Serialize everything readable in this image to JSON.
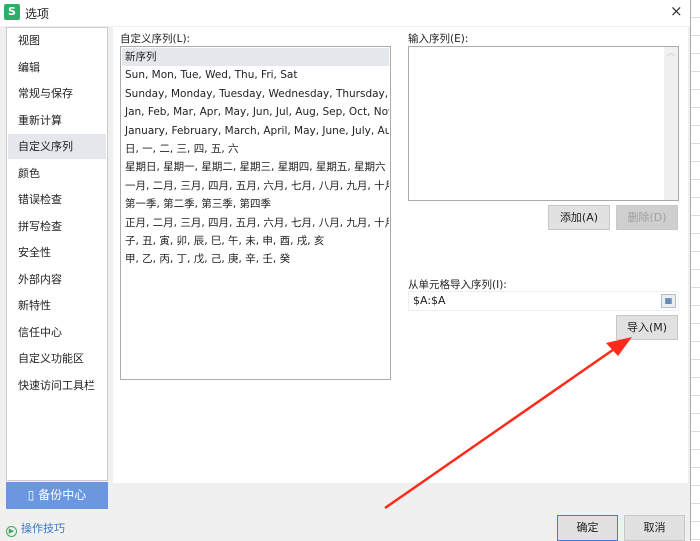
{
  "window": {
    "title": "选项",
    "app_icon": "S",
    "close_icon": "×"
  },
  "sidebar": {
    "items": [
      {
        "label": "视图"
      },
      {
        "label": "编辑"
      },
      {
        "label": "常规与保存"
      },
      {
        "label": "重新计算"
      },
      {
        "label": "自定义序列",
        "selected": true
      },
      {
        "label": "颜色"
      },
      {
        "label": "错误检查"
      },
      {
        "label": "拼写检查"
      },
      {
        "label": "安全性"
      },
      {
        "label": "外部内容"
      },
      {
        "label": "新特性"
      },
      {
        "label": "信任中心"
      },
      {
        "label": "自定义功能区"
      },
      {
        "label": "快速访问工具栏"
      }
    ]
  },
  "custom_lists": {
    "label": "自定义序列(L):",
    "items": [
      "新序列",
      "Sun, Mon, Tue, Wed, Thu, Fri, Sat",
      "Sunday, Monday, Tuesday, Wednesday, Thursday, Frid...",
      "Jan, Feb, Mar, Apr, May, Jun, Jul, Aug, Sep, Oct, Nov, ...",
      "January, February, March, April, May, June, July, Augus...",
      "日, 一, 二, 三, 四, 五, 六",
      "星期日, 星期一, 星期二, 星期三, 星期四, 星期五, 星期六",
      "一月, 二月, 三月, 四月, 五月, 六月, 七月, 八月, 九月, 十月, ...",
      "第一季, 第二季, 第三季, 第四季",
      "正月, 二月, 三月, 四月, 五月, 六月, 七月, 八月, 九月, 十月, ...",
      "子, 丑, 寅, 卯, 辰, 巳, 午, 未, 申, 酉, 戌, 亥",
      "甲, 乙, 丙, 丁, 戊, 己, 庚, 辛, 壬, 癸"
    ]
  },
  "entries": {
    "label": "输入序列(E):",
    "value": ""
  },
  "buttons": {
    "add": "添加(A)",
    "delete": "删除(D)",
    "import": "导入(M)",
    "ok": "确定",
    "cancel": "取消"
  },
  "import_from": {
    "label": "从单元格导入序列(I):",
    "value": "$A:$A"
  },
  "backup": {
    "label": "备份中心"
  },
  "tips": {
    "label": "操作技巧"
  },
  "annotation": {
    "arrow_color": "#ff2a1a"
  }
}
